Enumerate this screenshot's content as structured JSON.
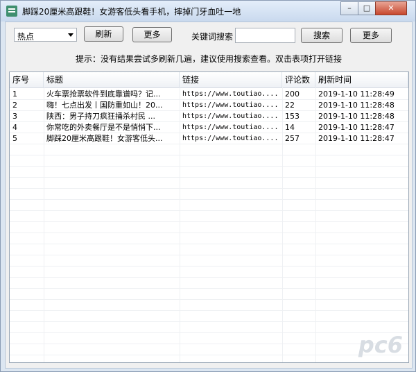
{
  "window": {
    "title": "脚踩20厘米高跟鞋！女游客低头看手机，摔掉门牙血吐一地"
  },
  "toolbar": {
    "category_value": "热点",
    "refresh_label": "刷新",
    "more_label": "更多",
    "search_label": "关键词搜索",
    "search_value": "",
    "search_button_label": "搜索",
    "more2_label": "更多"
  },
  "hint": "提示：没有结果尝试多刷新几遍，建议使用搜索查看。双击表项打开链接",
  "table": {
    "columns": [
      "序号",
      "标题",
      "链接",
      "评论数",
      "刷新时间"
    ],
    "rows": [
      {
        "index": "1",
        "title": "火车票抢票软件到底靠谱吗？记...",
        "link": "https://www.toutiao....",
        "comments": "200",
        "time": "2019-1-10 11:28:49"
      },
      {
        "index": "2",
        "title": "嗨！七点出发丨国防重如山！20...",
        "link": "https://www.toutiao....",
        "comments": "22",
        "time": "2019-1-10 11:28:48"
      },
      {
        "index": "3",
        "title": "陕西：男子持刀疯狂捅杀村民 ...",
        "link": "https://www.toutiao....",
        "comments": "153",
        "time": "2019-1-10 11:28:48"
      },
      {
        "index": "4",
        "title": "你常吃的外卖餐厅是不是悄悄下...",
        "link": "https://www.toutiao....",
        "comments": "14",
        "time": "2019-1-10 11:28:47"
      },
      {
        "index": "5",
        "title": "脚踩20厘米高跟鞋！女游客低头...",
        "link": "https://www.toutiao....",
        "comments": "257",
        "time": "2019-1-10 11:28:47"
      }
    ]
  },
  "watermark": "pc6"
}
